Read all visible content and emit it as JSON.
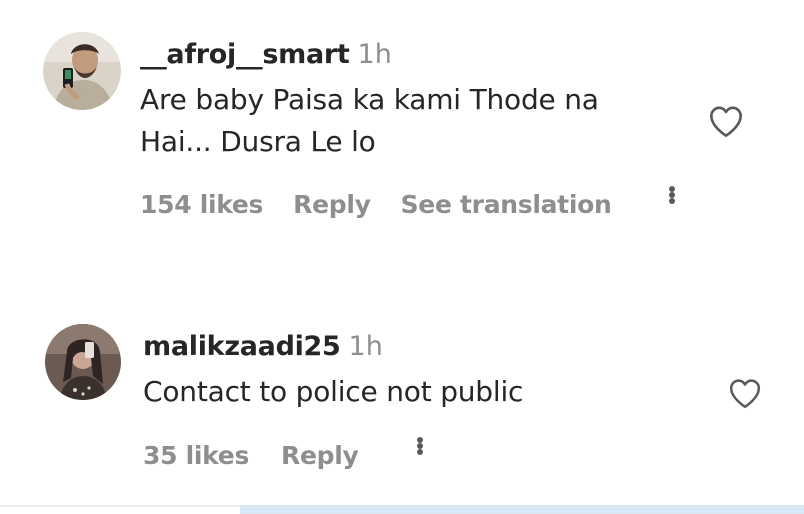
{
  "comments": [
    {
      "username": "__afroj__smart",
      "time": "1h",
      "text_line1": "Are baby Paisa ka kami Thode na",
      "text_line2": "Hai... Dusra Le lo",
      "likes": "154 likes",
      "reply": "Reply",
      "translate": "See translation",
      "more_icon": "ellipsis-icon",
      "like_icon": "heart-outline-icon"
    },
    {
      "username": "malikzaadi25",
      "time": "1h",
      "text": "Contact to police not public",
      "likes": "35 likes",
      "reply": "Reply",
      "more_icon": "ellipsis-icon",
      "like_icon": "heart-outline-icon"
    }
  ],
  "colors": {
    "text_primary": "#262626",
    "text_secondary": "#8e8e8e",
    "bottom_strip": "#d7e8f4"
  }
}
